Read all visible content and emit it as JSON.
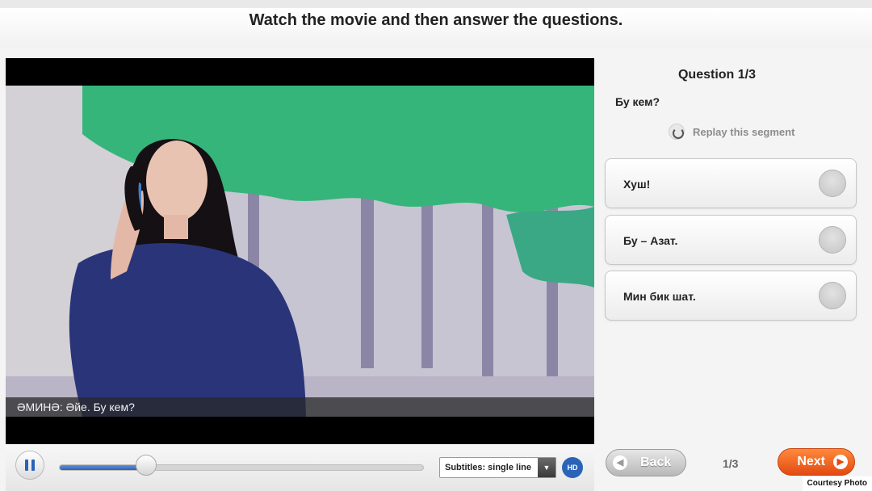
{
  "header": {
    "title": "Watch the movie and then answer the questions."
  },
  "video": {
    "subtitle": "ӘМИНӘ: Әйе. Бу кем?",
    "progress": 0.24
  },
  "player": {
    "subtitles_select": "Subtitles: single line",
    "hd_label": "HD",
    "pause_icon": "pause-icon"
  },
  "question": {
    "heading": "Question 1/3",
    "text": "Бу кем?",
    "replay_label": "Replay this segment",
    "answers": [
      {
        "label": "Хуш!"
      },
      {
        "label": "Бу – Азат."
      },
      {
        "label": "Мин бик шат."
      }
    ]
  },
  "nav": {
    "back_label": "Back",
    "page_count": "1/3",
    "next_label": "Next"
  },
  "courtesy": "Courtesy Photo",
  "colors": {
    "accent_blue": "#2a63b8",
    "next_orange": "#e24a12"
  }
}
